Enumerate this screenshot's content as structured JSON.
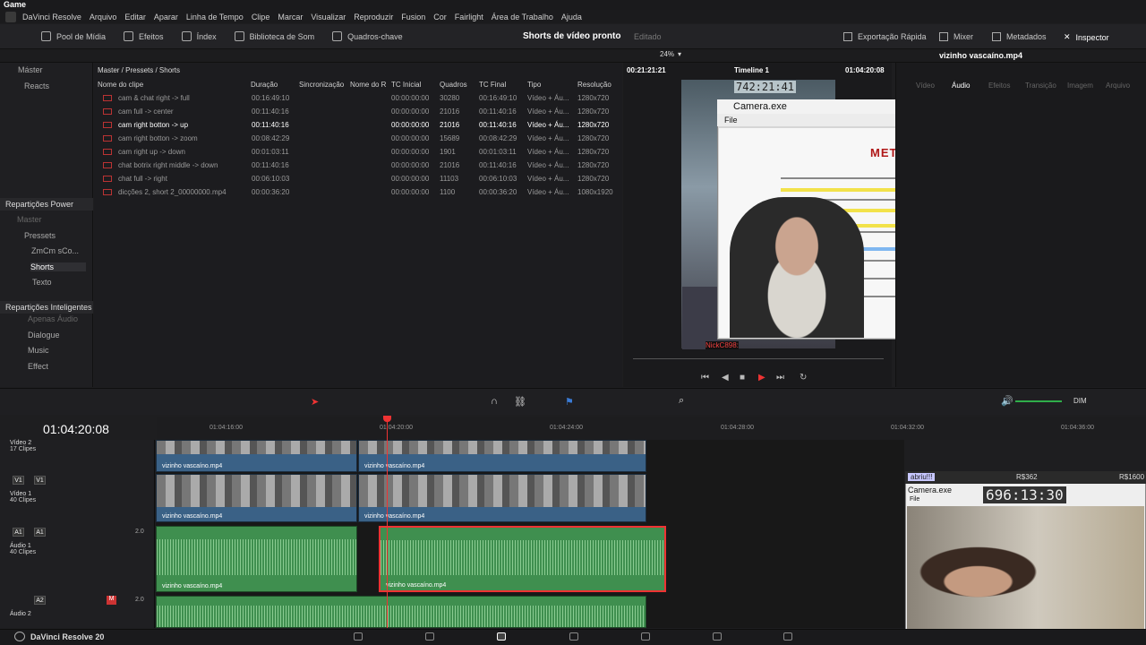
{
  "window": {
    "title": "Game"
  },
  "menu": [
    "DaVinci Resolve",
    "Arquivo",
    "Editar",
    "Aparar",
    "Linha de Tempo",
    "Clipe",
    "Marcar",
    "Visualizar",
    "Reproduzir",
    "Fusion",
    "Cor",
    "Fairlight",
    "Área de Trabalho",
    "Ajuda"
  ],
  "toolbar": {
    "left": [
      "Pool de Mídia",
      "Efeitos",
      "Índex",
      "Biblioteca de Som",
      "Quadros-chave"
    ],
    "project_title": "Shorts de vídeo pronto",
    "project_status": "Editado",
    "right": [
      "Exportação Rápida",
      "Mixer",
      "Metadados",
      "Inspector"
    ]
  },
  "left_panel": {
    "master": "Máster",
    "reacts": "Reacts",
    "power_bins_header": "Repartições Power",
    "power_items": [
      "Master",
      "Pressets",
      "ZmCm sCo...",
      "Shorts",
      "Texto"
    ],
    "smart_bins_header": "Repartições Inteligentes",
    "smart_items": [
      "Apenas Áudio",
      "Dialogue",
      "Music",
      "Effect"
    ]
  },
  "media_pool": {
    "breadcrumb": "Master / Pressets / Shorts",
    "columns": [
      "Nome do clipe",
      "Duração",
      "Sincronização",
      "Nome do R",
      "TC Inicial",
      "Quadros",
      "TC Final",
      "Tipo",
      "Resolução"
    ],
    "rows": [
      {
        "name": "cam & chat right -> full",
        "dur": "00:16:49:10",
        "tc_in": "00:00:00:00",
        "frames": "30280",
        "tc_out": "00:16:49:10",
        "type": "Vídeo + Áu...",
        "res": "1280x720"
      },
      {
        "name": "cam full -> center",
        "dur": "00:11:40:16",
        "tc_in": "00:00:00:00",
        "frames": "21016",
        "tc_out": "00:11:40:16",
        "type": "Vídeo + Áu...",
        "res": "1280x720"
      },
      {
        "name": "cam right botton -> up",
        "dur": "00:11:40:16",
        "tc_in": "00:00:00:00",
        "frames": "21016",
        "tc_out": "00:11:40:16",
        "type": "Vídeo + Áu...",
        "res": "1280x720"
      },
      {
        "name": "cam right botton -> zoom",
        "dur": "00:08:42:29",
        "tc_in": "00:00:00:00",
        "frames": "15689",
        "tc_out": "00:08:42:29",
        "type": "Vídeo + Áu...",
        "res": "1280x720"
      },
      {
        "name": "cam right up -> down",
        "dur": "00:01:03:11",
        "tc_in": "00:00:00:00",
        "frames": "1901",
        "tc_out": "00:01:03:11",
        "type": "Vídeo + Áu...",
        "res": "1280x720"
      },
      {
        "name": "chat botrix right middle -> down",
        "dur": "00:11:40:16",
        "tc_in": "00:00:00:00",
        "frames": "21016",
        "tc_out": "00:11:40:16",
        "type": "Vídeo + Áu...",
        "res": "1280x720"
      },
      {
        "name": "chat full -> right",
        "dur": "00:06:10:03",
        "tc_in": "00:00:00:00",
        "frames": "11103",
        "tc_out": "00:06:10:03",
        "type": "Vídeo + Áu...",
        "res": "1280x720"
      },
      {
        "name": "dicções 2, short 2_00000000.mp4",
        "dur": "00:00:36:20",
        "tc_in": "00:00:00:00",
        "frames": "1100",
        "tc_out": "00:00:36:20",
        "type": "Vídeo + Áu...",
        "res": "1080x1920"
      }
    ]
  },
  "viewer": {
    "zoom": "24%",
    "tc_left": "00:21:21:21",
    "timeline_name": "Timeline 1",
    "tc_right": "01:04:20:08",
    "clock": "742:21:41",
    "chat_name": "NickC898:"
  },
  "camera_window": {
    "title": "Camera.exe",
    "menu": "File",
    "site_logo": "METRÓPOLES"
  },
  "inspector": {
    "clip": "vizinho vascaíno.mp4",
    "tabs": [
      "Vídeo",
      "Áudio",
      "Efeitos",
      "Transição",
      "Imagem",
      "Arquivo"
    ]
  },
  "timeline": {
    "timecode": "01:04:20:08",
    "ruler": [
      "01:04:16:00",
      "01:04:20:00",
      "01:04:24:00",
      "01:04:28:00",
      "01:04:32:00",
      "01:04:36:00"
    ],
    "tracks": [
      {
        "name": "Vídeo 2",
        "count": "17 Clipes"
      },
      {
        "name": "Vídeo 1",
        "count": "40 Clipes",
        "tag": "V1"
      },
      {
        "name": "Áudio 1",
        "count": "40 Clipes",
        "tag": "A1",
        "gain": "2.0"
      },
      {
        "name": "Áudio 2",
        "tag": "A2",
        "gain": "2.0"
      }
    ],
    "clip_label": "vizinho vascaíno.mp4",
    "dim": "DIM"
  },
  "webcam": {
    "user": "abriu!!!",
    "price1": "R$362",
    "price2": "R$1600",
    "title": "Camera.exe",
    "clock": "696:13:30",
    "file": "File"
  },
  "status": {
    "app": "DaVinci Resolve 20"
  }
}
